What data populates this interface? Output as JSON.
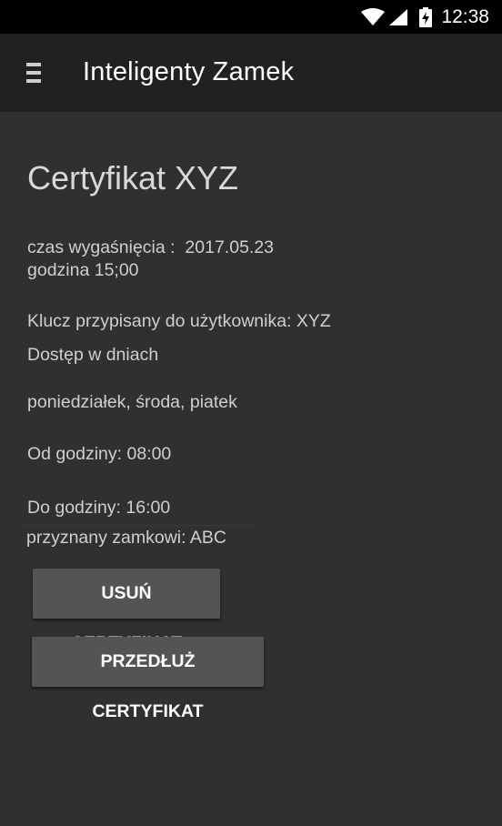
{
  "status_bar": {
    "time": "12:38",
    "icons": [
      "wifi-icon",
      "signal-icon",
      "battery-charging-icon"
    ]
  },
  "toolbar": {
    "menu_icon": "menu-icon",
    "title": "Inteligenty Zamek"
  },
  "certificate": {
    "title": "Certyfikat XYZ",
    "expiry_label": "czas wygaśnięcia :",
    "expiry_date": "2017.05.23",
    "expiry_time": "godzina 15;00",
    "assigned_user": "Klucz przypisany do użytkownika: XYZ",
    "access_days_label": "Dostęp w dniach",
    "access_days": "poniedziałek, środa, piatek",
    "from_hour": "Od godziny: 08:00",
    "to_hour": "Do godziny: 16:00",
    "lock": "przyznany zamkowi: ABC"
  },
  "actions": {
    "delete_label": "USUŃ CERTYFIKAT",
    "extend_label": "PRZEDŁUŻ CERTYFIKAT"
  },
  "colors": {
    "background": "#303030",
    "toolbar": "#212121",
    "status_bar": "#000000",
    "button": "#545454",
    "text": "#cfcfcf"
  }
}
